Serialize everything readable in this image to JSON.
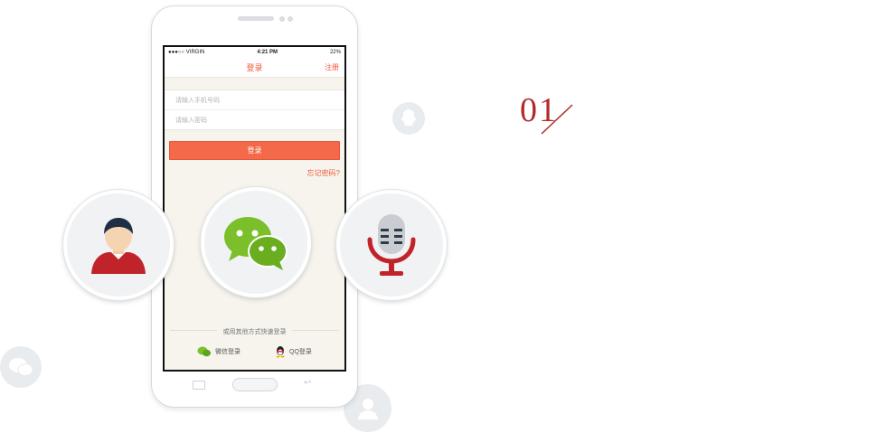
{
  "status_bar": {
    "carrier": "●●●○○ VIRGIN",
    "time": "4:21 PM",
    "battery": "22%"
  },
  "nav": {
    "title": "登录",
    "register": "注册"
  },
  "form": {
    "phone_placeholder": "请输入手机号码",
    "password_placeholder": "请输入密码"
  },
  "login_button": "登录",
  "forgot_password": "忘记密码?",
  "alt_login": {
    "label": "或用其他方式快速登录",
    "wechat": "微信登录",
    "qq": "QQ登录"
  },
  "step": {
    "number": "01"
  },
  "colors": {
    "accent": "#f05a3a",
    "button": "#f4694a",
    "step": "#b22a2a",
    "wechat_green": "#7bc02a"
  },
  "icons": [
    "user-avatar-icon",
    "wechat-icon",
    "microphone-icon",
    "qq-icon",
    "chat-bubble-icon",
    "person-icon"
  ]
}
